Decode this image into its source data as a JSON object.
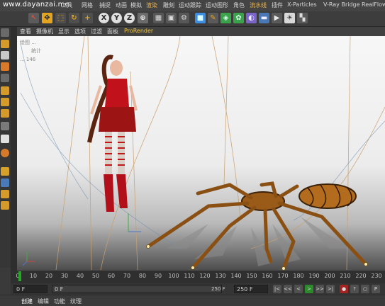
{
  "watermark": "www.dayanzai.me",
  "menu": {
    "items": [
      "网格",
      "捕捉",
      "动画",
      "模拟",
      "渲染",
      "雕刻",
      "运动跟踪",
      "运动图形",
      "角色",
      "流水线",
      "插件",
      "X-Particles",
      "V-Ray Bridge",
      "RealFlow"
    ],
    "highlighted": [
      "渲染",
      "流水线"
    ],
    "partial_left": "工具"
  },
  "toolbar": {
    "icons": [
      "select-arrow-icon",
      "move-icon",
      "scale-icon",
      "rotate-icon",
      "add-icon",
      "x-axis-icon",
      "y-axis-icon",
      "z-axis-icon",
      "coordinate-system-icon",
      "render-region-icon",
      "render-view-icon",
      "render-settings-icon",
      "cube-icon",
      "pen-icon",
      "subdivision-icon",
      "array-icon",
      "deformer-icon",
      "floor-icon",
      "camera-icon",
      "light-icon",
      "checker-icon"
    ]
  },
  "view_menu": {
    "items": [
      "查看",
      "摄像机",
      "显示",
      "选项",
      "过滤",
      "面板"
    ],
    "prorender": "ProRender"
  },
  "hud": {
    "line1": "绘图 ...",
    "line2": "统计",
    "line3": "... 146"
  },
  "timeline": {
    "ticks": [
      "0",
      "10",
      "20",
      "30",
      "40",
      "50",
      "60",
      "70",
      "80",
      "90",
      "100",
      "110",
      "120",
      "130",
      "140",
      "150",
      "160",
      "170",
      "180",
      "190",
      "200",
      "210",
      "220",
      "230"
    ],
    "current_frame": "0"
  },
  "controls": {
    "start": "0 F",
    "current": "0 F",
    "end": "250 F",
    "max": "250 F",
    "buttons": [
      "|<",
      "<<",
      "<",
      ">",
      ">>",
      ">|",
      "●",
      "?",
      "○",
      "P"
    ]
  },
  "bottom_tabs": {
    "items": [
      "创建",
      "编辑",
      "功能",
      "纹理"
    ],
    "active": "创建"
  },
  "colors": {
    "accent_orange": "#f3b94b",
    "prorender_yellow": "#f3c93f",
    "playhead_green": "#27a727"
  }
}
